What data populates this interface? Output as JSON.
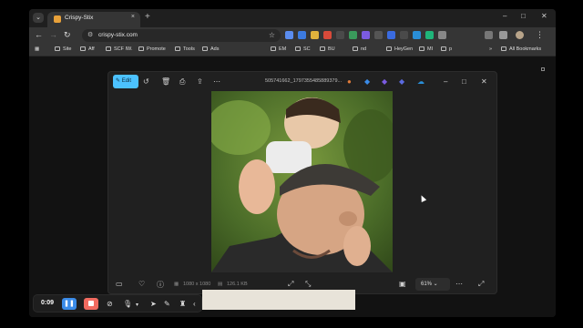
{
  "browser": {
    "tab_title": "Crispy-Stix",
    "tab_close": "×",
    "new_tab": "+",
    "url": "crispy-stix.com",
    "window_minimize": "–",
    "window_maximize": "□",
    "window_close": "✕"
  },
  "bookmarks": [
    "Site",
    "Aff",
    "SCF IW.",
    "Promote",
    "Tools",
    "Ads",
    "EM",
    "SC",
    "BU",
    "nd",
    "HeyGen",
    "MI",
    "p",
    "All Bookmarks"
  ],
  "viewer": {
    "edit_label": "Edit",
    "filename": "505741662_1797355485889379...",
    "dimensions": "1080 x 1080",
    "filesize": "126.1 KB",
    "zoom": "61%"
  },
  "recorder": {
    "time": "0:09"
  },
  "colors": {
    "accent": "#4cc2ff",
    "pause": "#3a8be8",
    "stop": "#f26b60"
  }
}
